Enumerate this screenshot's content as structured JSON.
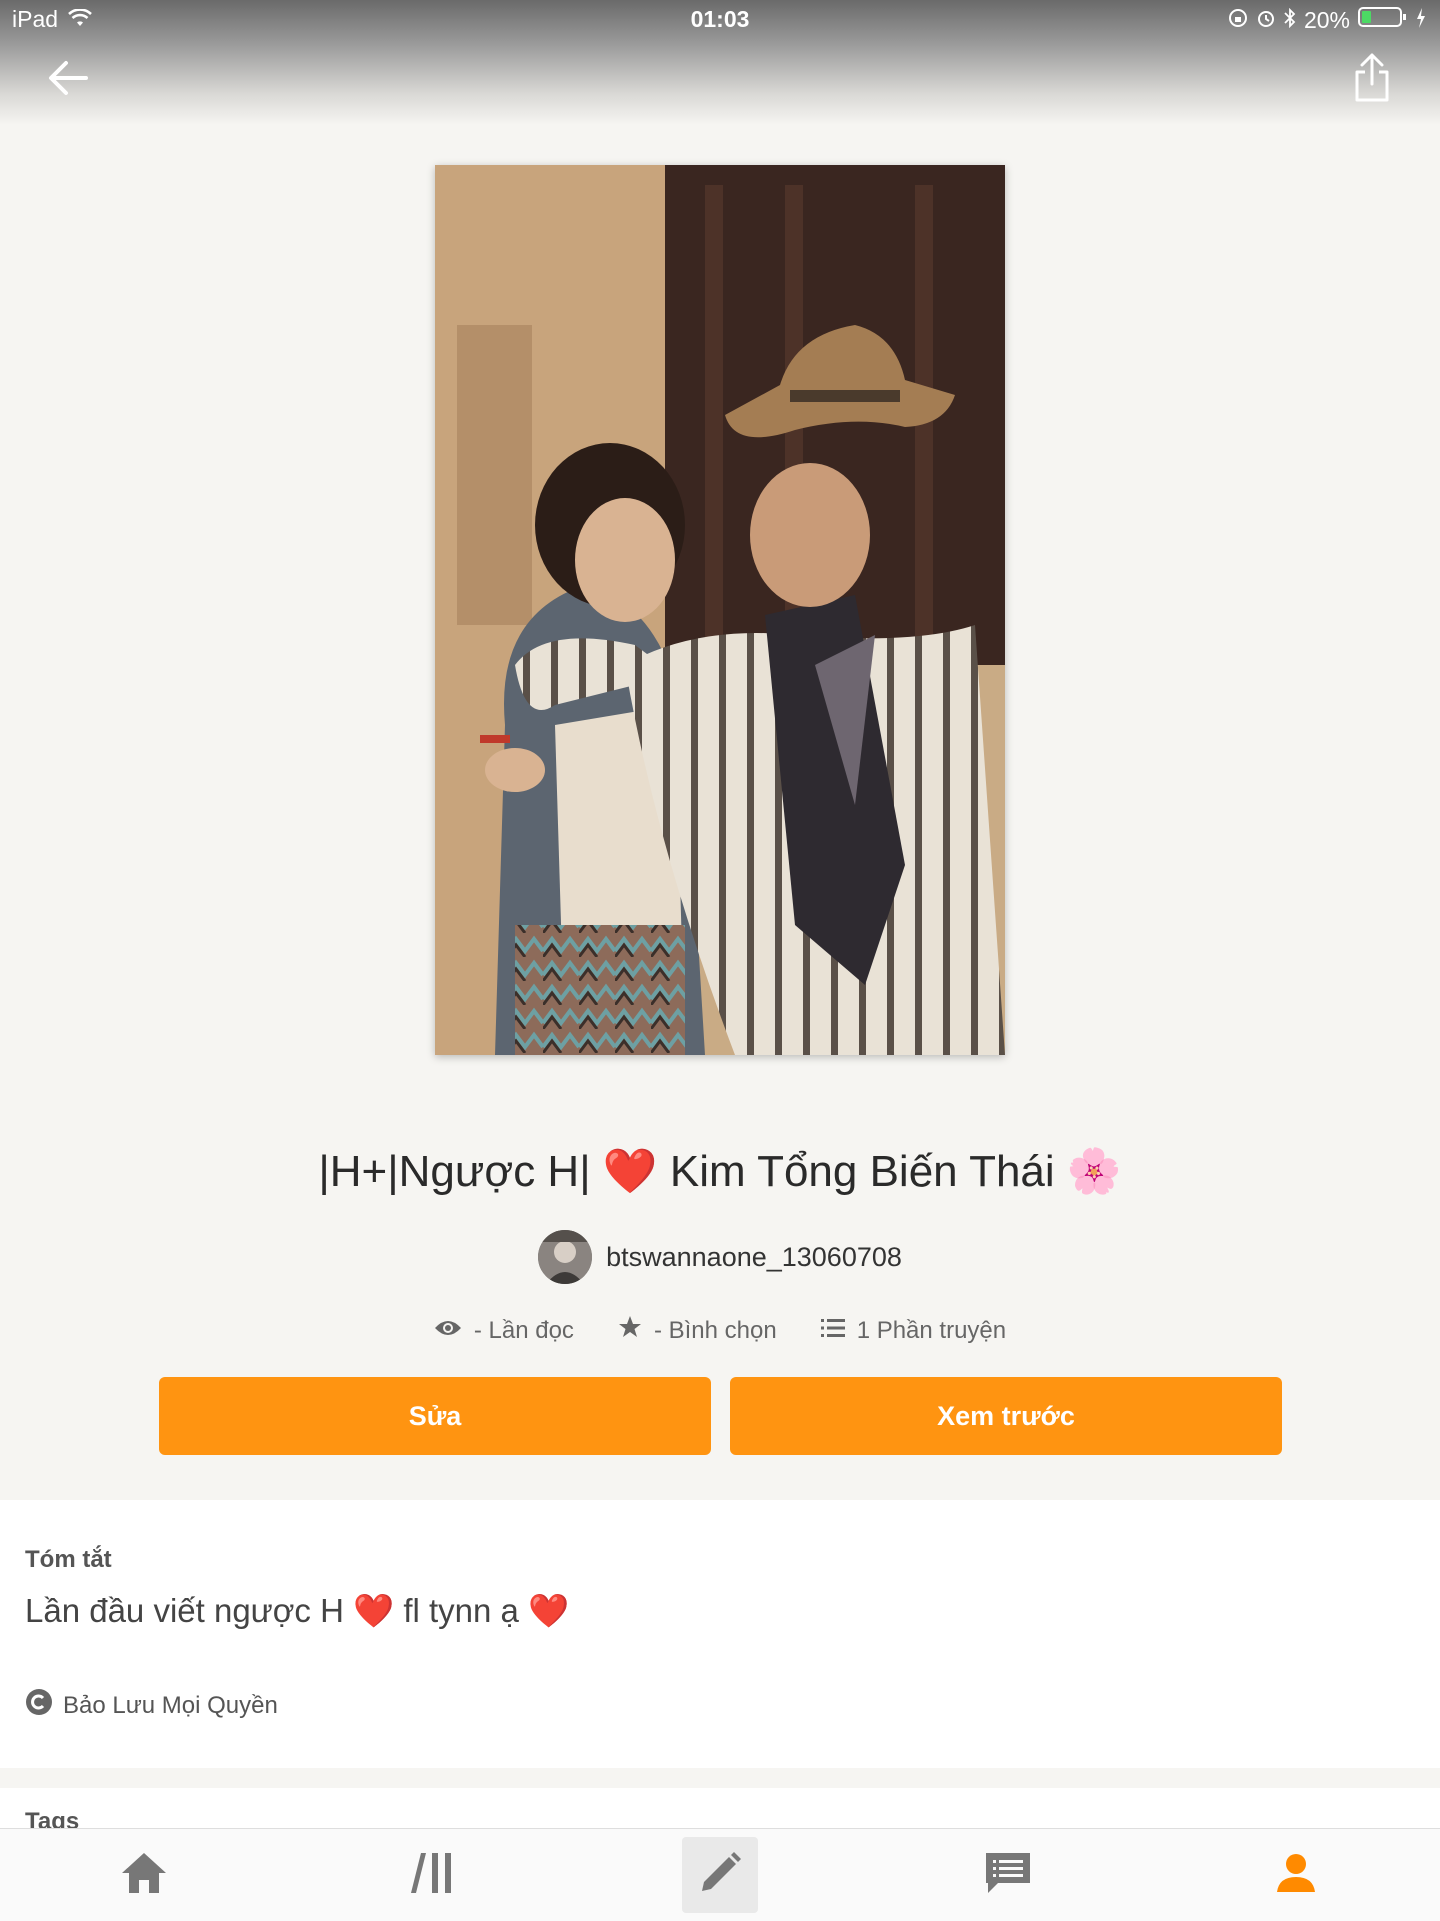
{
  "status_bar": {
    "device": "iPad",
    "time": "01:03",
    "battery": "20%"
  },
  "story": {
    "title": "|H+|Ngược H| ❤️ Kim Tổng Biến Thái 🌸",
    "author": "btswannaone_13060708",
    "stats": {
      "reads": "- Lần đọc",
      "votes": "- Bình chọn",
      "parts": "1 Phần truyện"
    }
  },
  "actions": {
    "edit_label": "Sửa",
    "preview_label": "Xem trước"
  },
  "summary": {
    "heading": "Tóm tắt",
    "text": "Lần đầu viết ngược H ❤️ fl tynn ạ ❤️",
    "copyright": "Bảo Lưu Mọi Quyền"
  },
  "tags": {
    "heading": "Tags"
  },
  "tabs": [
    {
      "name": "home",
      "icon": "home-icon"
    },
    {
      "name": "library",
      "icon": "library-icon"
    },
    {
      "name": "write",
      "icon": "pencil-icon",
      "active": true
    },
    {
      "name": "messages",
      "icon": "message-icon"
    },
    {
      "name": "profile",
      "icon": "profile-icon",
      "color": "#ff8a00"
    }
  ],
  "colors": {
    "accent": "#ff9411",
    "background": "#f6f5f2"
  }
}
